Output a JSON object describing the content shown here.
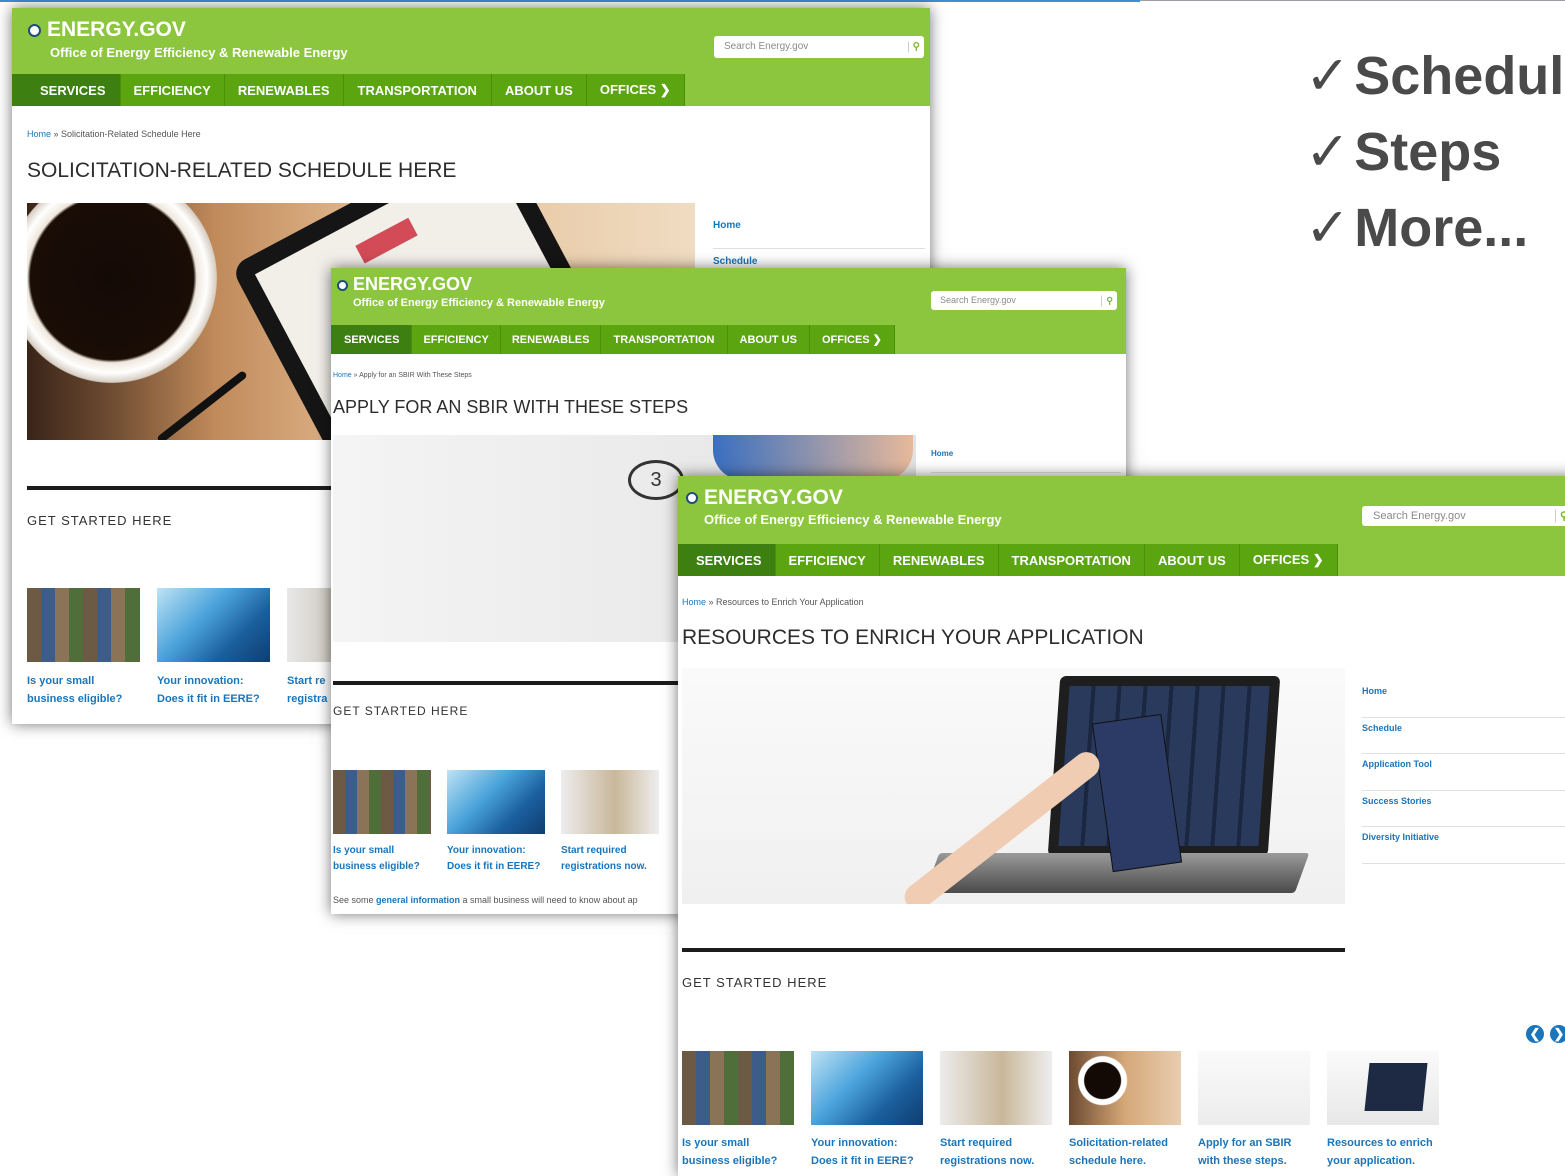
{
  "bullets": [
    "Schedule",
    "Steps",
    "More..."
  ],
  "bullet_check": "✓",
  "site": {
    "logo": "ENERGY.GOV",
    "office": "Office of Energy Efficiency & Renewable Energy",
    "search_placeholder": "Search Energy.gov",
    "nav": [
      "SERVICES",
      "EFFICIENCY",
      "RENEWABLES",
      "TRANSPORTATION",
      "ABOUT US",
      "OFFICES ❯"
    ]
  },
  "shot1": {
    "crumb_home": "Home",
    "crumb_rest": " » Solicitation-Related Schedule Here",
    "title": "SOLICITATION-RELATED SCHEDULE HERE",
    "side": [
      "Home",
      "Schedule"
    ],
    "section": "GET STARTED HERE",
    "tiles": [
      {
        "l1": "Is your small",
        "l2": "business eligible?"
      },
      {
        "l1": "Your innovation:",
        "l2": "Does it fit in EERE?"
      },
      {
        "l1": "Start re",
        "l2": "registra"
      }
    ]
  },
  "shot2": {
    "crumb_home": "Home",
    "crumb_rest": " » Apply for an SBIR With These Steps",
    "title": "APPLY FOR AN SBIR WITH THESE STEPS",
    "side": [
      "Home"
    ],
    "section": "GET STARTED HERE",
    "tiles": [
      {
        "l1": "Is your small",
        "l2": "business eligible?"
      },
      {
        "l1": "Your innovation:",
        "l2": "Does it fit in EERE?"
      },
      {
        "l1": "Start required",
        "l2": "registrations now."
      }
    ],
    "para_pre": "See some ",
    "para_link": "general information",
    "para_post": " a small business will need to know about ap"
  },
  "shot3": {
    "crumb_home": "Home",
    "crumb_rest": " » Resources to Enrich Your Application",
    "title": "RESOURCES TO ENRICH YOUR APPLICATION",
    "side": [
      "Home",
      "Schedule",
      "Application Tool",
      "Success Stories",
      "Diversity Initiative"
    ],
    "section": "GET STARTED HERE",
    "tiles": [
      {
        "l1": "Is your small",
        "l2": "business eligible?"
      },
      {
        "l1": "Your innovation:",
        "l2": "Does it fit in EERE?"
      },
      {
        "l1": "Start required",
        "l2": "registrations now."
      },
      {
        "l1": "Solicitation-related",
        "l2": "schedule here."
      },
      {
        "l1": "Apply for an SBIR",
        "l2": "with these steps."
      },
      {
        "l1": "Resources to enrich",
        "l2": "your application."
      }
    ],
    "arrow_prev": "❮",
    "arrow_next": "❯"
  },
  "colors": {
    "header_green": "#8cc63f",
    "nav_green": "#5aa510",
    "link_blue": "#1a75bb"
  }
}
